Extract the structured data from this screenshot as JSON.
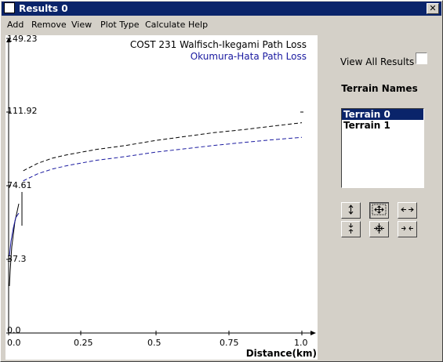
{
  "window": {
    "title": "Results 0",
    "close_label": "✕"
  },
  "menu": [
    "Add",
    "Remove",
    "View",
    "Plot Type",
    "Calculate",
    "Help"
  ],
  "plot": {
    "legend": [
      "COST 231 Walfisch-Ikegami  Path Loss",
      "Okumura-Hata  Path Loss"
    ],
    "y_ticks": [
      "149.23",
      "111.92",
      "74.61",
      "37.3",
      "0.0"
    ],
    "x_ticks": [
      "0.0",
      "0.25",
      "0.5",
      "0.75",
      "1.0"
    ],
    "x_label": "Distance(km)"
  },
  "chart_data": {
    "type": "line",
    "xlabel": "Distance(km)",
    "ylabel": "",
    "xlim": [
      0,
      1.05
    ],
    "ylim": [
      0,
      149.23
    ],
    "series": [
      {
        "name": "COST 231 Walfisch-Ikegami  Path Loss",
        "color": "#000000",
        "x": [
          0.05,
          0.1,
          0.15,
          0.2,
          0.3,
          0.4,
          0.5,
          0.6,
          0.7,
          0.8,
          0.9,
          1.0
        ],
        "y": [
          82.2,
          86.0,
          88.6,
          90.3,
          93.0,
          95.0,
          97.5,
          99.5,
          101.5,
          103.0,
          104.8,
          106.5
        ]
      },
      {
        "name": "Okumura-Hata  Path Loss",
        "color": "#1a1aa0",
        "x": [
          0.05,
          0.1,
          0.15,
          0.2,
          0.3,
          0.4,
          0.5,
          0.6,
          0.7,
          0.8,
          0.9,
          1.0
        ],
        "y": [
          77.1,
          80.7,
          83.1,
          84.8,
          87.5,
          89.4,
          91.6,
          93.3,
          95.0,
          96.5,
          97.9,
          99.1
        ]
      }
    ]
  },
  "side": {
    "view_all_label": "View All Results",
    "view_all_checked": false,
    "terrain_title": "Terrain Names",
    "terrains": [
      "Terrain 0",
      "Terrain 1"
    ],
    "selected_terrain": "Terrain 0"
  }
}
